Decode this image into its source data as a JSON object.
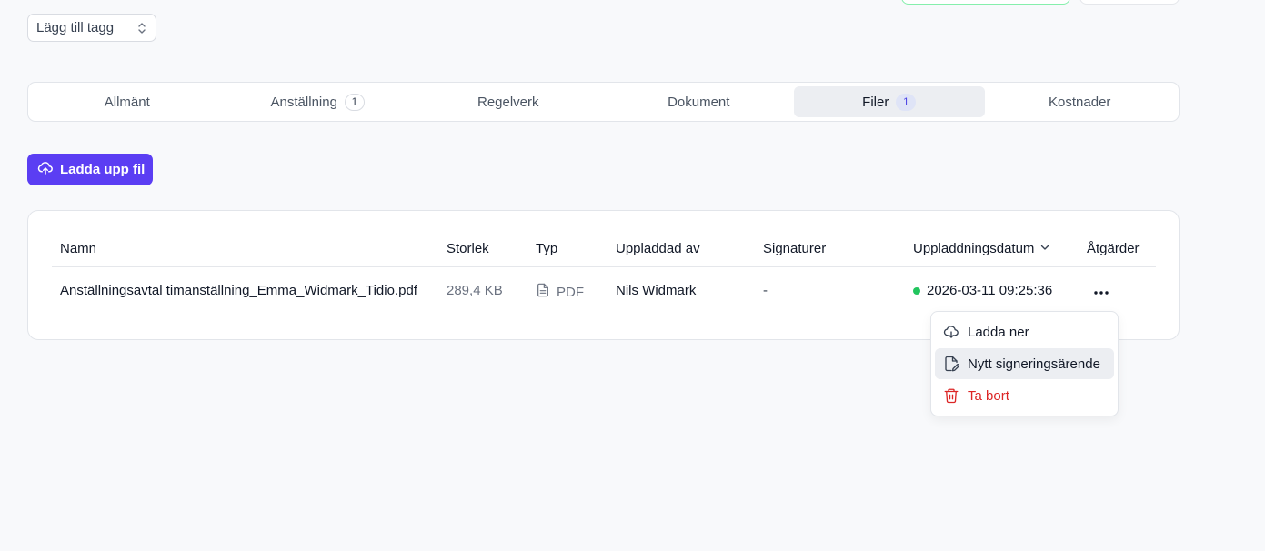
{
  "tag_select": {
    "label": "Lägg till tagg"
  },
  "tabs": [
    {
      "label": "Allmänt"
    },
    {
      "label": "Anställning",
      "badge": "1"
    },
    {
      "label": "Regelverk"
    },
    {
      "label": "Dokument"
    },
    {
      "label": "Filer",
      "badge": "1",
      "active": true
    },
    {
      "label": "Kostnader"
    }
  ],
  "upload_button": {
    "label": "Ladda upp fil"
  },
  "table": {
    "columns": {
      "name": "Namn",
      "size": "Storlek",
      "type": "Typ",
      "uploaded_by": "Uppladdad av",
      "signatures": "Signaturer",
      "upload_date": "Uppladdningsdatum",
      "actions": "Åtgärder"
    },
    "rows": [
      {
        "name": "Anställningsavtal timanställning_Emma_Widmark_Tidio.pdf",
        "size": "289,4 KB",
        "type": "PDF",
        "uploaded_by": "Nils Widmark",
        "signatures": "-",
        "upload_date": "2026-03-11 09:25:36"
      }
    ]
  },
  "row_menu": {
    "items": [
      {
        "label": "Ladda ner",
        "icon": "cloud-download-icon"
      },
      {
        "label": "Nytt signeringsärende",
        "icon": "file-edit-icon"
      },
      {
        "label": "Ta bort",
        "icon": "trash-icon"
      }
    ]
  },
  "colors": {
    "accent": "#5b3ef3",
    "status_dot": "#22c55e",
    "danger": "#dc2626"
  }
}
